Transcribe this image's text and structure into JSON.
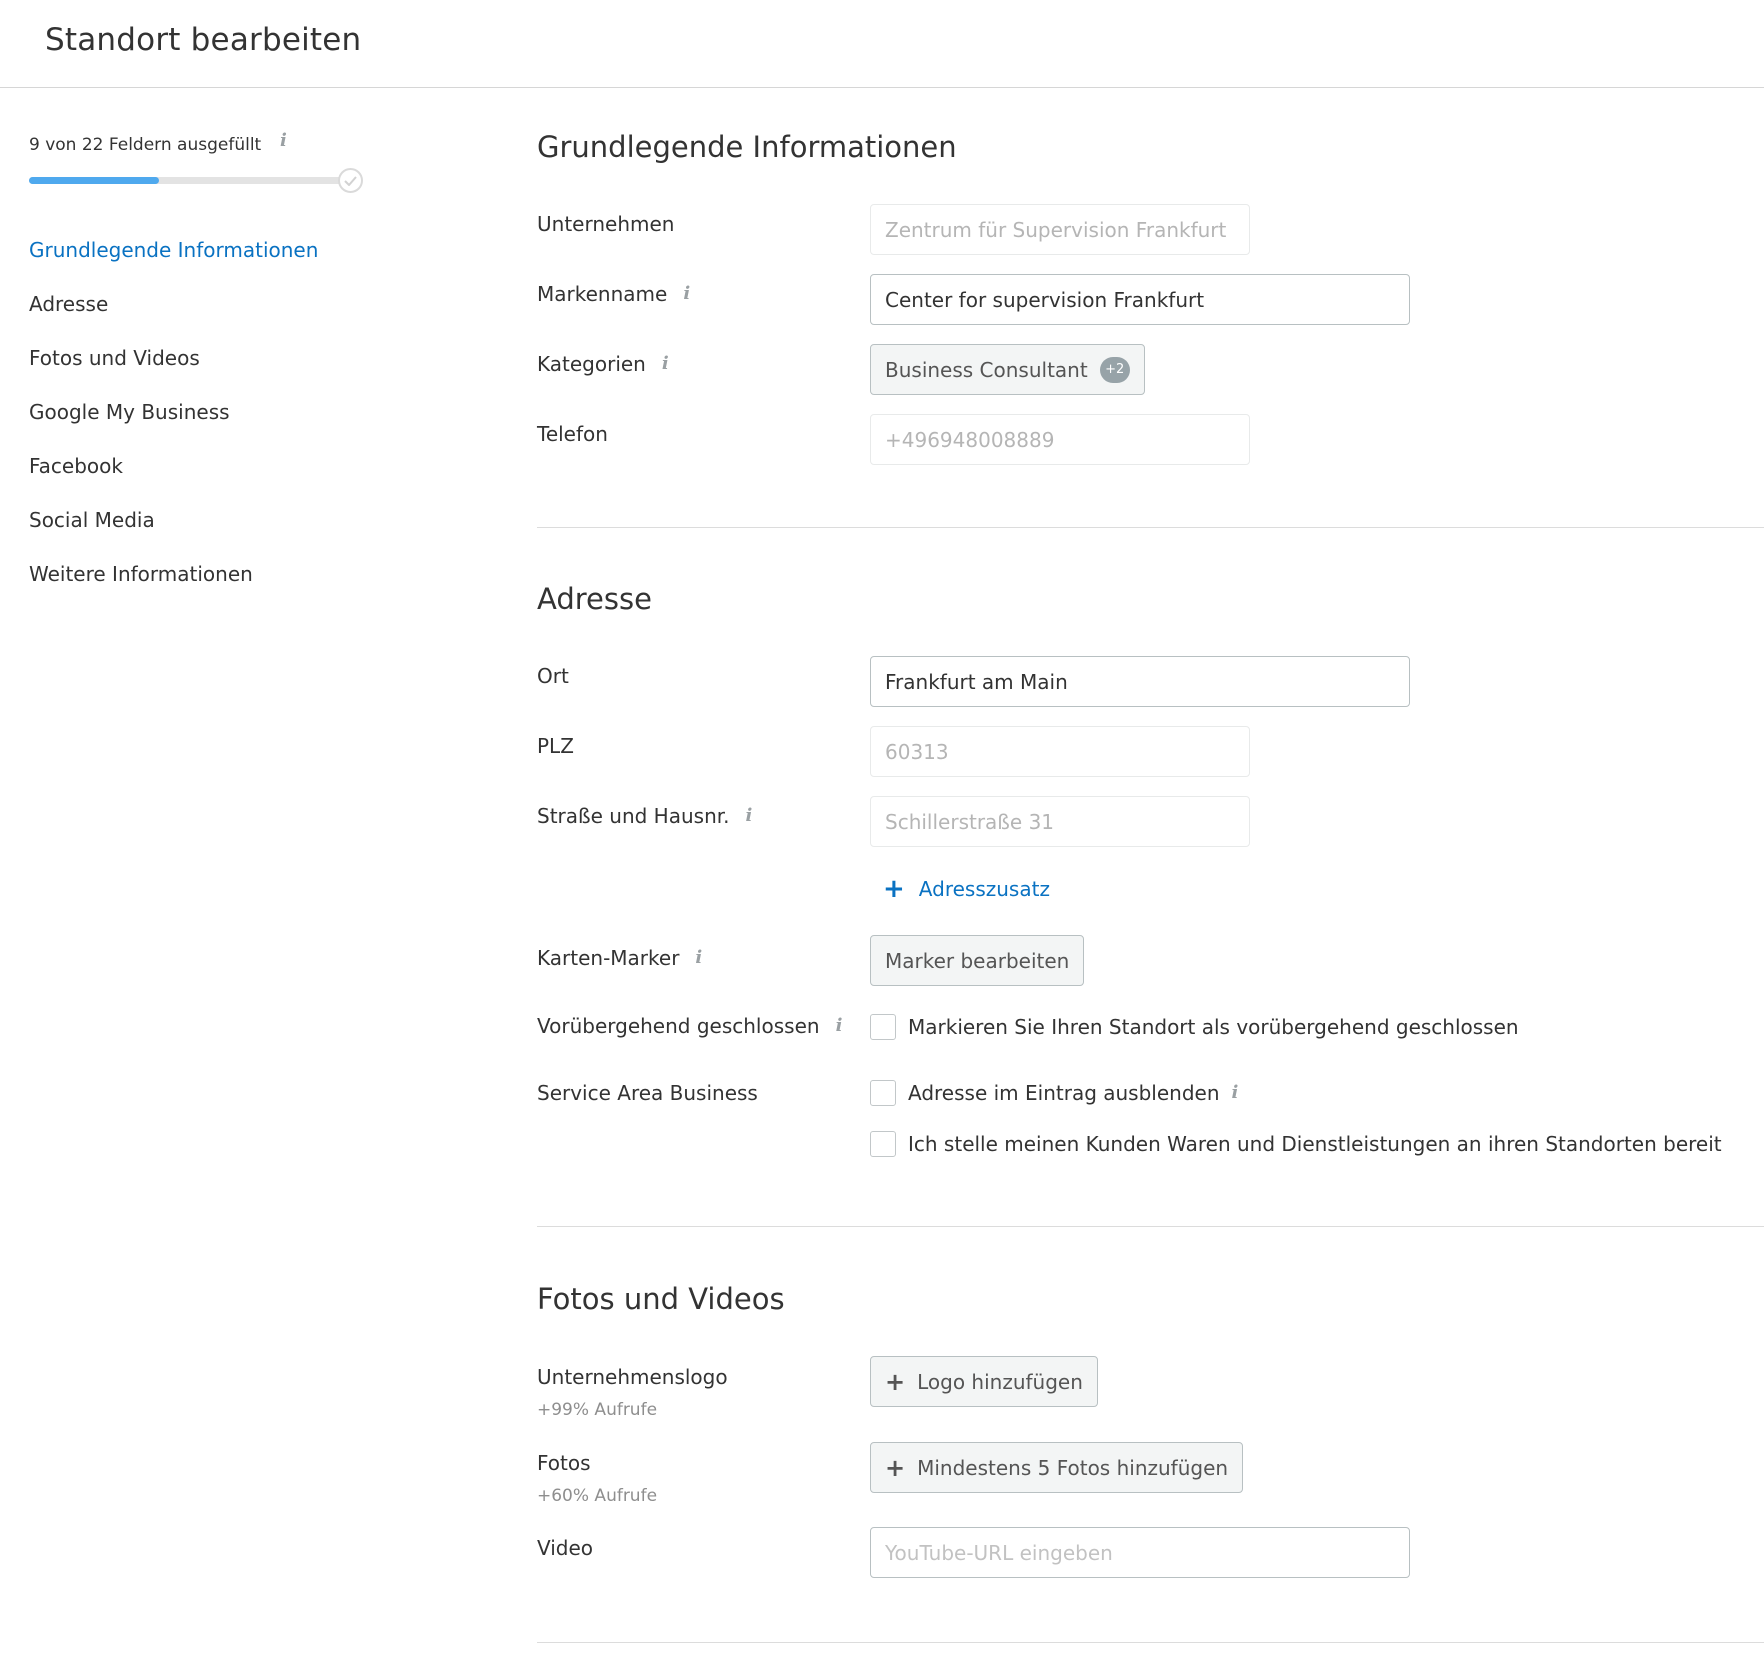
{
  "header": {
    "title": "Standort bearbeiten"
  },
  "sidebar": {
    "progress": {
      "text": "9 von 22 Feldern ausgefüllt",
      "filled": 9,
      "total": 22,
      "fill_fraction": 0.41,
      "info_icon": "info-icon"
    },
    "nav": [
      {
        "label": "Grundlegende Informationen",
        "active": true
      },
      {
        "label": "Adresse",
        "active": false
      },
      {
        "label": "Fotos und Videos",
        "active": false
      },
      {
        "label": "Google My Business",
        "active": false
      },
      {
        "label": "Facebook",
        "active": false
      },
      {
        "label": "Social Media",
        "active": false
      },
      {
        "label": "Weitere Informationen",
        "active": false
      }
    ]
  },
  "basic": {
    "title": "Grundlegende Informationen",
    "company": {
      "label": "Unternehmen",
      "value": "Zentrum für Supervision Frankfurt"
    },
    "brand": {
      "label": "Markenname",
      "value": "Center for supervision Frankfurt"
    },
    "categories": {
      "label": "Kategorien",
      "value": "Business Consultant",
      "extra": "+2"
    },
    "phone": {
      "label": "Telefon",
      "value": "+496948008889"
    }
  },
  "address": {
    "title": "Adresse",
    "city": {
      "label": "Ort",
      "value": "Frankfurt am Main"
    },
    "zip": {
      "label": "PLZ",
      "value": "60313"
    },
    "street": {
      "label": "Straße und Hausnr.",
      "value": "Schillerstraße 31"
    },
    "addition_link": "Adresszusatz",
    "marker": {
      "label": "Karten-Marker",
      "button": "Marker bearbeiten"
    },
    "temp_closed": {
      "label": "Vorübergehend geschlossen",
      "checkbox": "Markieren Sie Ihren Standort als vorübergehend geschlossen",
      "checked": false
    },
    "sab": {
      "label": "Service Area Business",
      "hide_address": {
        "text": "Adresse im Eintrag ausblenden",
        "checked": false
      },
      "deliver": {
        "text": "Ich stelle meinen Kunden Waren und Dienstleistungen an ihren Standorten bereit",
        "checked": false
      }
    }
  },
  "media": {
    "title": "Fotos und Videos",
    "logo": {
      "label": "Unternehmenslogo",
      "sub": "+99% Aufrufe",
      "button": "Logo hinzufügen"
    },
    "photos": {
      "label": "Fotos",
      "sub": "+60% Aufrufe",
      "button": "Mindestens 5 Fotos hinzufügen"
    },
    "video": {
      "label": "Video",
      "placeholder": "YouTube-URL eingeben"
    }
  },
  "colors": {
    "accent": "#0a72c2",
    "progress": "#4fa9ee",
    "badge": "#97a3a8"
  }
}
